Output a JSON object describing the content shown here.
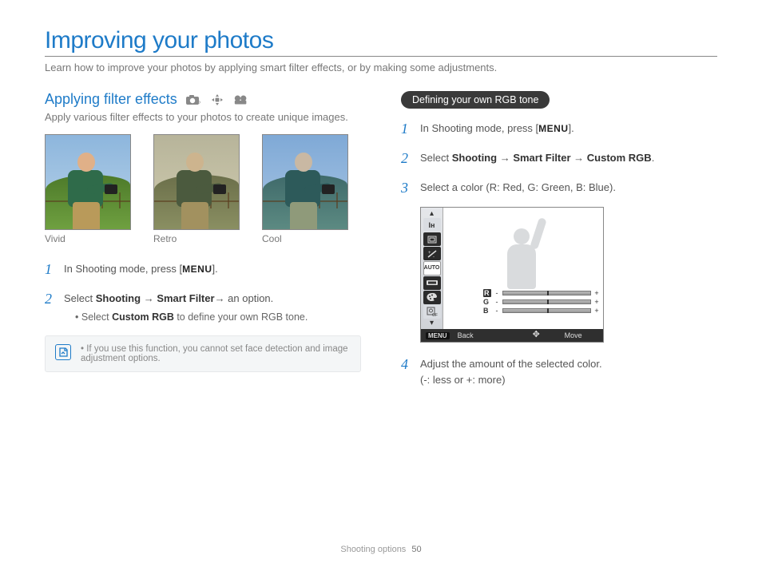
{
  "page": {
    "title": "Improving your photos",
    "intro": "Learn how to improve your photos by applying smart filter effects, or by making some adjustments."
  },
  "left": {
    "section_title": "Applying filter effects",
    "section_intro": "Apply various filter effects to your photos to create unique images.",
    "thumbs": [
      {
        "label": "Vivid"
      },
      {
        "label": "Retro"
      },
      {
        "label": "Cool"
      }
    ],
    "step1_prefix": "In Shooting mode, press [",
    "step1_menu": "MENU",
    "step1_suffix": "].",
    "step2_prefix": "Select ",
    "step2_b1": "Shooting",
    "step2_arrow1": " → ",
    "step2_b2": "Smart Filter",
    "step2_suffix": "→ an option.",
    "step2_sub_prefix": "Select ",
    "step2_sub_bold": "Custom RGB",
    "step2_sub_suffix": " to define your own RGB tone.",
    "note": "If you use this function, you cannot set face detection and image adjustment options."
  },
  "right": {
    "pill": "Defining your own RGB tone",
    "step1_prefix": "In Shooting mode, press [",
    "step1_menu": "MENU",
    "step1_suffix": "].",
    "step2_prefix": "Select ",
    "step2_b1": "Shooting",
    "step2_arrow1": " → ",
    "step2_b2": "Smart Filter",
    "step2_arrow2": " → ",
    "step2_b3": "Custom RGB",
    "step2_suffix": ".",
    "step3": "Select a color (R: Red, G: Green, B: Blue).",
    "step4_line1": "Adjust the amount of the selected color.",
    "step4_line2": "(-: less or +: more)",
    "screen": {
      "sliders": [
        {
          "label": "R",
          "selected": true
        },
        {
          "label": "G",
          "selected": false
        },
        {
          "label": "B",
          "selected": false
        }
      ],
      "side_auto": "AUTO",
      "back_key": "MENU",
      "back_label": "Back",
      "move_label": "Move"
    }
  },
  "nums": {
    "n1": "1",
    "n2": "2",
    "n3": "3",
    "n4": "4"
  },
  "footer": {
    "section": "Shooting options",
    "page": "50"
  }
}
